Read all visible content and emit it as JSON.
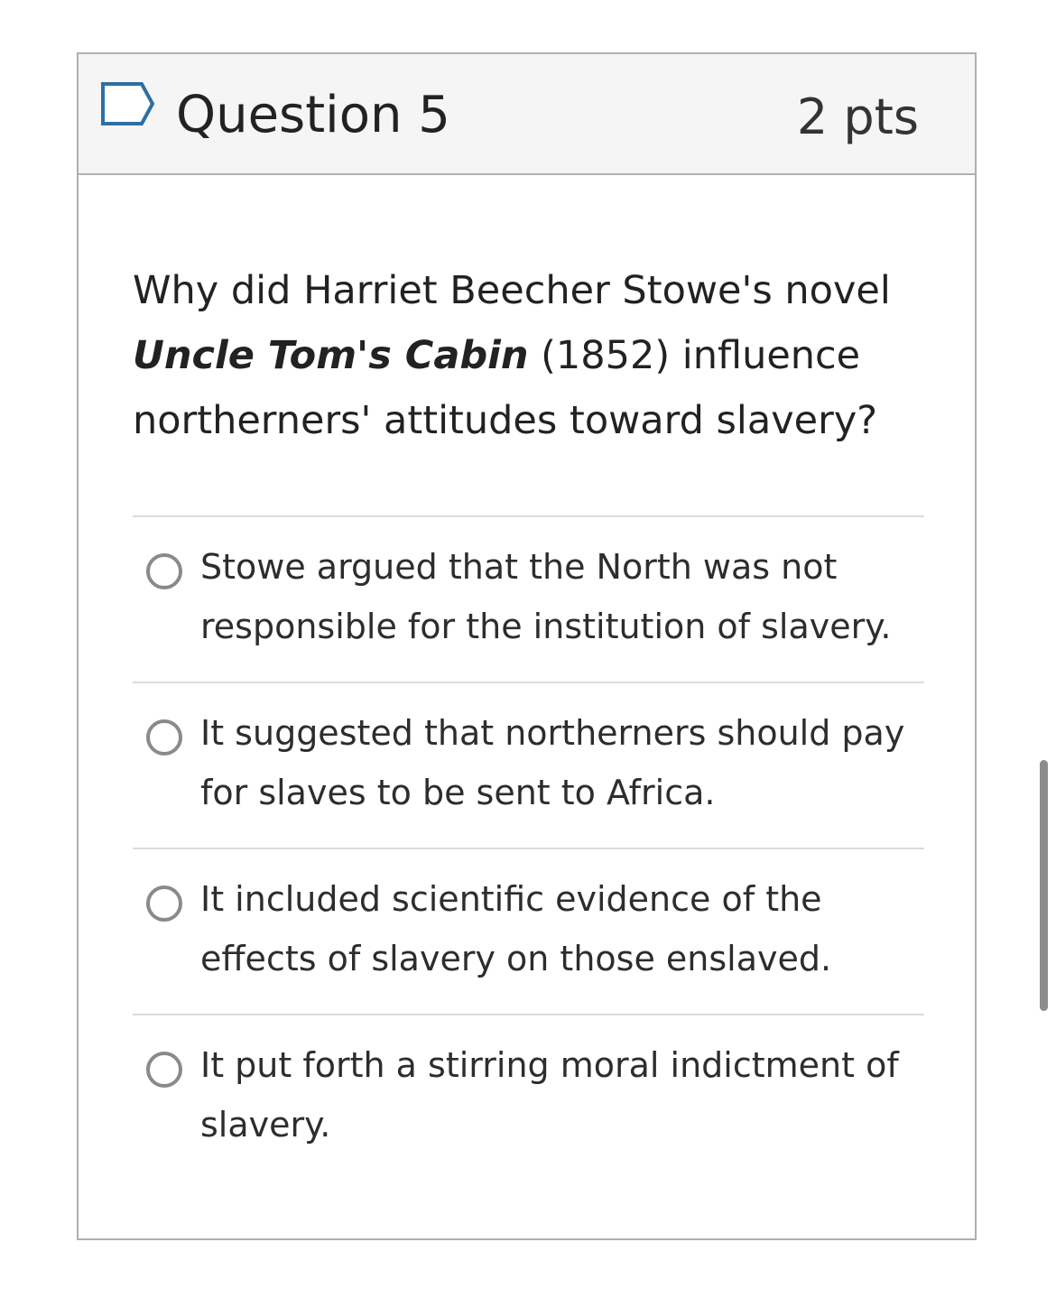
{
  "question": {
    "title": "Question 5",
    "points": "2 pts",
    "text_before": "Why did Harriet Beecher Stowe's novel ",
    "text_emphasis": "Uncle Tom's Cabin",
    "text_after": " (1852) influence northerners' attitudes toward slavery?"
  },
  "answers": [
    {
      "label": "Stowe argued that the North was not responsible for the institution of slavery."
    },
    {
      "label": "It suggested that northerners should pay for slaves to be sent to Africa."
    },
    {
      "label": "It included scientific evidence of the effects of slavery on those enslaved."
    },
    {
      "label": "It put forth a stirring moral indictment of slavery."
    }
  ],
  "colors": {
    "header_bg": "#f5f5f5",
    "flag_outline": "#2d6fa3",
    "border": "#b0b0b0",
    "radio": "#8a8a8a"
  },
  "icons": {
    "flag": "bookmark-flag-icon"
  }
}
